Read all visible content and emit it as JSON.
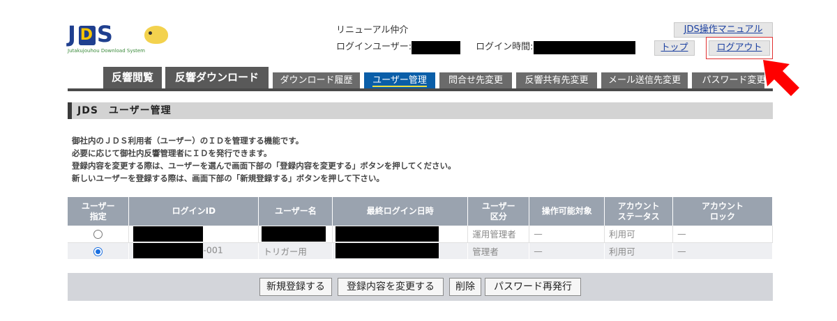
{
  "logo": {
    "text_left": "J",
    "text_mark": "D",
    "text_right": "S",
    "subtitle": "Jutakujouhou Download System"
  },
  "header": {
    "company": "リニューアル仲介",
    "login_user_label": "ログインユーザー:",
    "login_time_label": "ログイン時間:"
  },
  "links": {
    "manual": "JDS操作マニュアル",
    "top": "トップ",
    "logout": "ログアウト"
  },
  "tabs": [
    {
      "label": "反響閲覧"
    },
    {
      "label": "反響ダウンロード"
    },
    {
      "label": "ダウンロード履歴"
    },
    {
      "label": "ユーザー管理"
    },
    {
      "label": "問合せ先変更"
    },
    {
      "label": "反響共有先変更"
    },
    {
      "label": "メール送信先変更"
    },
    {
      "label": "パスワード変更"
    }
  ],
  "section_title": "JDS　ユーザー管理",
  "description": [
    "御社内のＪＤＳ利用者（ユーザー）のＩＤを管理する機能です。",
    "必要に応じて御社内反響管理者にＩＤを発行できます。",
    "登録内容を変更する際は、ユーザーを選んで画面下部の「登録内容を変更する」ボタンを押してください。",
    "新しいユーザーを登録する際は、画面下部の「新規登録する」ボタンを押して下さい。"
  ],
  "table": {
    "headers": {
      "select_1": "ユーザー",
      "select_2": "指定",
      "login_id": "ログインID",
      "user_name": "ユーザー名",
      "last_login": "最終ログイン日時",
      "category_1": "ユーザー",
      "category_2": "区分",
      "target": "操作可能対象",
      "status_1": "アカウント",
      "status_2": "ステータス",
      "lock_1": "アカウント",
      "lock_2": "ロック"
    },
    "rows": [
      {
        "selected": false,
        "login_id_suffix": "",
        "user_name": "",
        "category": "運用管理者",
        "target": "—",
        "status": "利用可",
        "lock": "—"
      },
      {
        "selected": true,
        "login_id_suffix": "-001",
        "user_name": "トリガー用",
        "category": "管理者",
        "target": "—",
        "status": "利用可",
        "lock": "—"
      }
    ]
  },
  "buttons": {
    "register": "新規登録する",
    "edit": "登録内容を変更する",
    "delete": "削除",
    "reissue": "パスワード再発行"
  },
  "colors": {
    "active_tab": "#0a5ea8",
    "tab": "#595959",
    "table_header": "#9aa3af",
    "highlight_box": "#e03030",
    "arrow": "#ff0000"
  }
}
